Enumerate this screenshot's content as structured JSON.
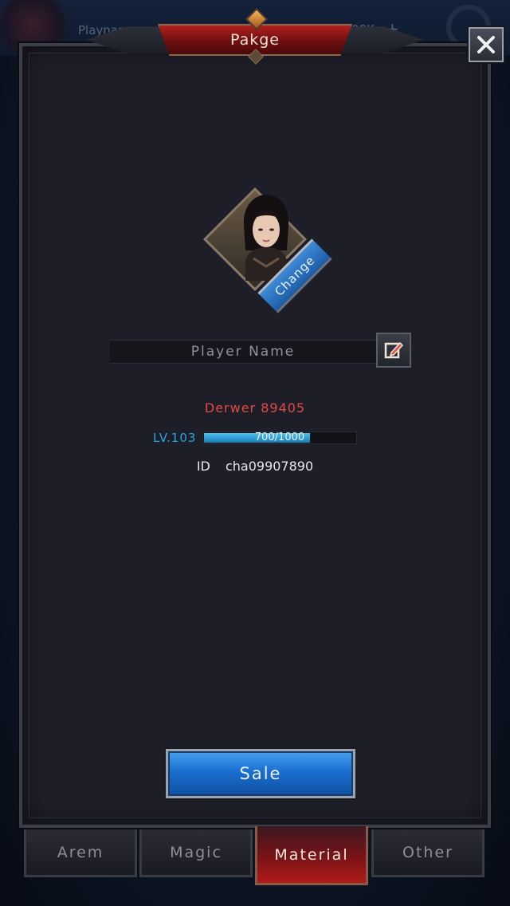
{
  "background": {
    "player_name": "Playnamename",
    "gold": "9098K",
    "plus": "+"
  },
  "title": "Pakge",
  "portrait": {
    "change_label": "Change"
  },
  "profile": {
    "name_placeholder": "Player Name",
    "power": "Derwer 89405",
    "level": "LV.103",
    "exp_text": "700/1000",
    "exp_fraction": 0.7,
    "id_label": "ID",
    "id_value": "cha09907890"
  },
  "actions": {
    "sale_label": "Sale"
  },
  "tabs": [
    {
      "label": "Arem",
      "active": false
    },
    {
      "label": "Magic",
      "active": false
    },
    {
      "label": "Material",
      "active": true
    },
    {
      "label": "Other",
      "active": false
    }
  ],
  "colors": {
    "power": "#e04a45",
    "level": "#25a7e0",
    "accent_blue": "#1a6fd0",
    "accent_red": "#b01a1a"
  },
  "icons": {
    "close": "close-icon",
    "edit": "edit-icon",
    "gear": "gear-icon"
  }
}
